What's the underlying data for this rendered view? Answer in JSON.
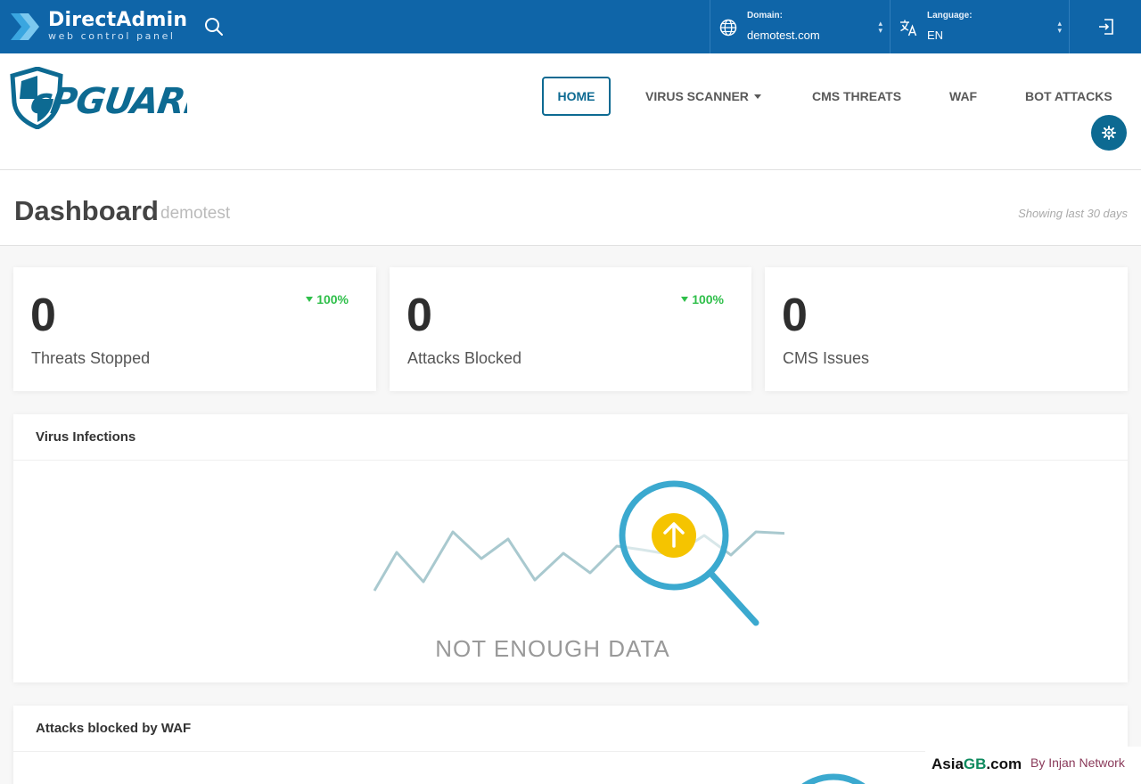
{
  "topbar": {
    "brand": "DirectAdmin",
    "brand_sub": "web control panel",
    "domain_label": "Domain:",
    "domain_value": "demotest.com",
    "language_label": "Language:",
    "language_value": "EN"
  },
  "nav": {
    "logo_text": "cPGUARD",
    "items": [
      {
        "label": "HOME"
      },
      {
        "label": "VIRUS SCANNER"
      },
      {
        "label": "CMS THREATS"
      },
      {
        "label": "WAF"
      },
      {
        "label": "BOT ATTACKS"
      }
    ]
  },
  "dashboard": {
    "title": "Dashboard",
    "subtitle": "demotest",
    "range": "Showing last 30 days"
  },
  "cards": [
    {
      "value": "0",
      "label": "Threats Stopped",
      "change": "100%"
    },
    {
      "value": "0",
      "label": "Attacks Blocked",
      "change": "100%"
    },
    {
      "value": "0",
      "label": "CMS Issues"
    }
  ],
  "panels": [
    {
      "title": "Virus Infections",
      "empty_text": "NOT ENOUGH DATA"
    },
    {
      "title": "Attacks blocked by WAF"
    }
  ],
  "watermark": {
    "brand_prefix": "Asia",
    "brand_mid": "GB",
    "brand_suffix": ".com",
    "by": "By Injan Network"
  },
  "colors": {
    "topbar": "#0f65a8",
    "accent": "#0d6a92",
    "positive": "#2fbf4a",
    "magnifier": "#3ba9cf",
    "upload": "#f5c400"
  },
  "icons": [
    "directadmin-logo-icon",
    "search-icon",
    "globe-icon",
    "translate-icon",
    "logout-icon",
    "cpguard-shield-icon",
    "gear-icon",
    "magnifier-icon",
    "upload-arrow-icon"
  ]
}
